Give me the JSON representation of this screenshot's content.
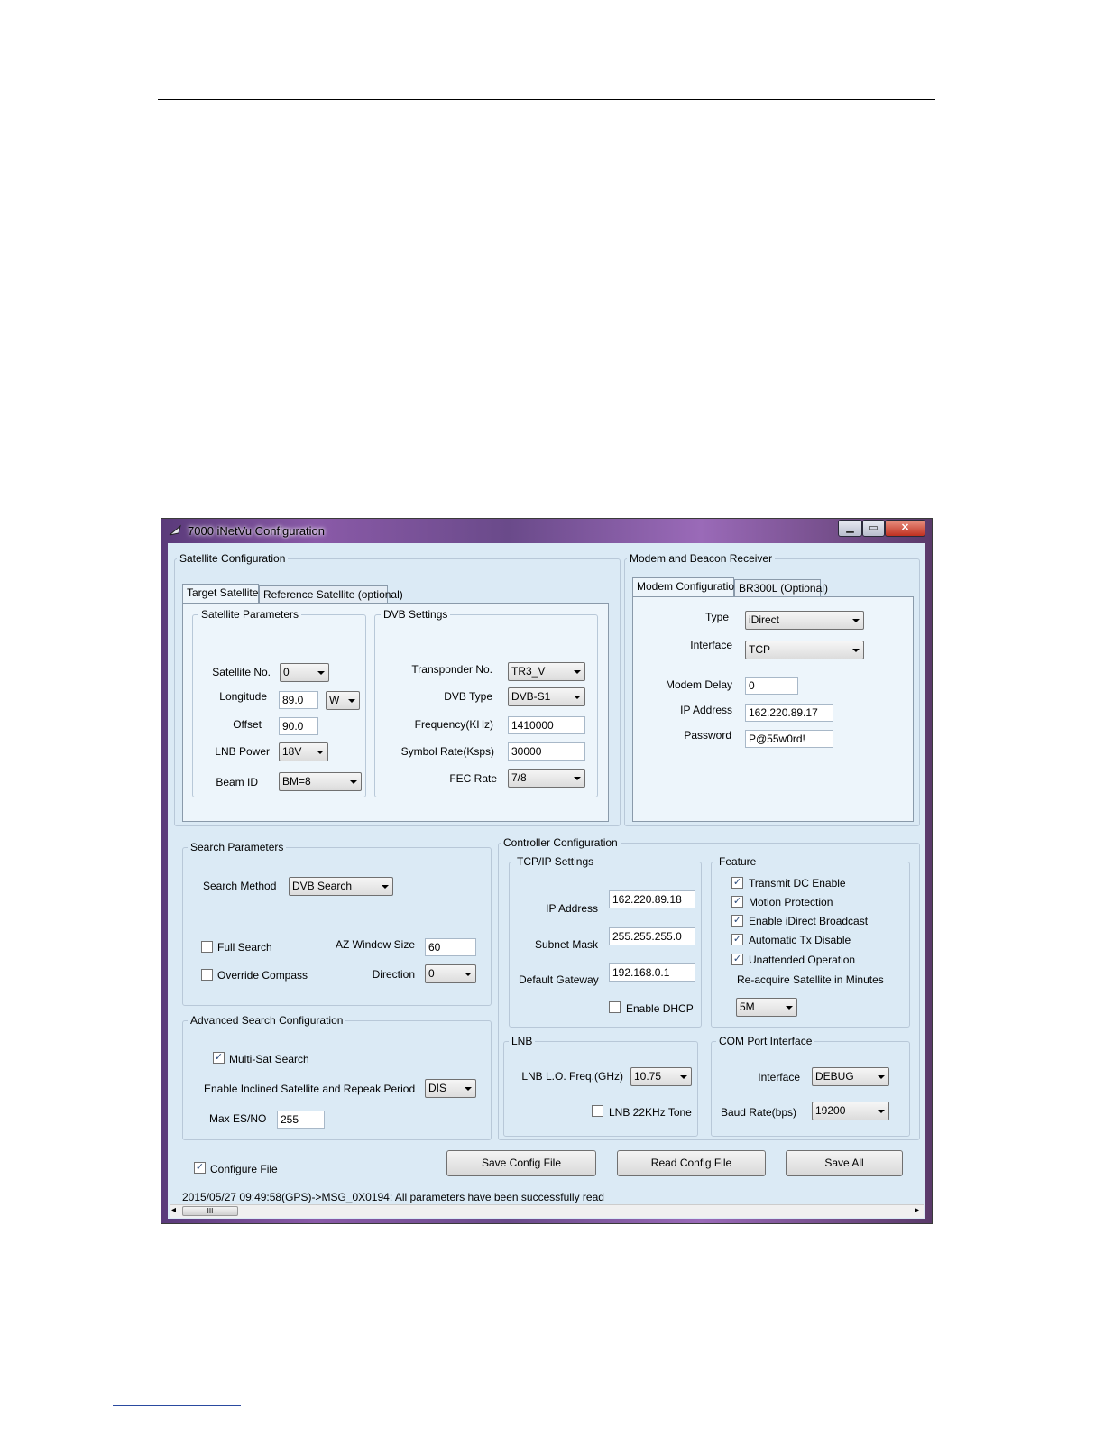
{
  "window": {
    "title": "7000 iNetVu Configuration",
    "minimize": "▁",
    "maximize": "▭",
    "close": "✕"
  },
  "satellite_config": {
    "title": "Satellite Configuration",
    "tabs": [
      "Target Satellite",
      "Reference Satellite (optional)"
    ],
    "satellite_parameters": {
      "title": "Satellite Parameters",
      "satellite_no_label": "Satellite No.",
      "satellite_no": "0",
      "longitude_label": "Longitude",
      "longitude": "89.0",
      "longitude_dir": "W",
      "offset_label": "Offset",
      "offset": "90.0",
      "lnb_power_label": "LNB Power",
      "lnb_power": "18V",
      "beam_id_label": "Beam ID",
      "beam_id": "BM=8"
    },
    "dvb_settings": {
      "title": "DVB Settings",
      "transponder_label": "Transponder No.",
      "transponder": "TR3_V",
      "dvb_type_label": "DVB Type",
      "dvb_type": "DVB-S1",
      "frequency_label": "Frequency(KHz)",
      "frequency": "1410000",
      "symbol_rate_label": "Symbol Rate(Ksps)",
      "symbol_rate": "30000",
      "fec_rate_label": "FEC Rate",
      "fec_rate": "7/8"
    }
  },
  "modem": {
    "title": "Modem and Beacon Receiver",
    "tabs": [
      "Modem Configuration",
      "BR300L (Optional)"
    ],
    "type_label": "Type",
    "type": "iDirect",
    "interface_label": "Interface",
    "interface": "TCP",
    "delay_label": "Modem Delay",
    "delay": "0",
    "ip_label": "IP Address",
    "ip": "162.220.89.17",
    "password_label": "Password",
    "password": "P@55w0rd!"
  },
  "search": {
    "title": "Search Parameters",
    "method_label": "Search Method",
    "method": "DVB Search",
    "full_search_label": "Full Search",
    "override_compass_label": "Override Compass",
    "az_window_label": "AZ Window Size",
    "az_window": "60",
    "direction_label": "Direction",
    "direction": "0"
  },
  "advanced_search": {
    "title": "Advanced Search Configuration",
    "multi_sat_label": "Multi-Sat Search",
    "inclined_label": "Enable Inclined Satellite and Repeak Period",
    "inclined": "DIS",
    "max_esno_label": "Max ES/NO",
    "max_esno": "255"
  },
  "controller": {
    "title": "Controller Configuration",
    "tcpip": {
      "title": "TCP/IP Settings",
      "ip_label": "IP Address",
      "ip": "162.220.89.18",
      "mask_label": "Subnet Mask",
      "mask": "255.255.255.0",
      "gateway_label": "Default Gateway",
      "gateway": "192.168.0.1",
      "dhcp_label": "Enable DHCP"
    },
    "feature": {
      "title": "Feature",
      "items": [
        "Transmit DC Enable",
        "Motion Protection",
        "Enable iDirect Broadcast",
        "Automatic Tx Disable",
        "Unattended Operation"
      ],
      "reacquire_label": "Re-acquire Satellite in Minutes",
      "reacquire": "5M"
    },
    "lnb": {
      "title": "LNB",
      "lo_label": "LNB L.O. Freq.(GHz)",
      "lo": "10.75",
      "tone_label": "LNB 22KHz Tone"
    },
    "com": {
      "title": "COM Port Interface",
      "interface_label": "Interface",
      "interface": "DEBUG",
      "baud_label": "Baud Rate(bps)",
      "baud": "19200"
    }
  },
  "footer": {
    "configure_file_label": "Configure File",
    "save_config": "Save Config File",
    "read_config": "Read Config File",
    "save_all": "Save All",
    "status": "2015/05/27 09:49:58(GPS)->MSG_0X0194: All parameters have been successfully read",
    "check_mark": "✓",
    "scroll_grip": "III",
    "scroll_left": "◂",
    "scroll_right": "▸"
  }
}
